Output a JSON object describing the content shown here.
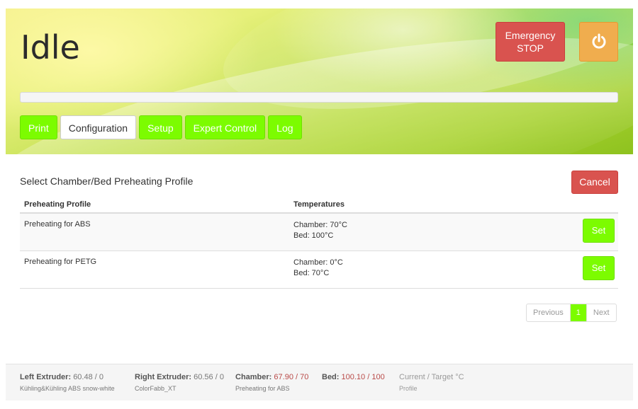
{
  "header": {
    "status": "Idle",
    "emergency_label_line1": "Emergency",
    "emergency_label_line2": "STOP",
    "progress": 0
  },
  "tabs": [
    {
      "label": "Print",
      "active": false
    },
    {
      "label": "Configuration",
      "active": true
    },
    {
      "label": "Setup",
      "active": false
    },
    {
      "label": "Expert Control",
      "active": false
    },
    {
      "label": "Log",
      "active": false
    }
  ],
  "main": {
    "title": "Select Chamber/Bed Preheating Profile",
    "cancel_label": "Cancel",
    "table": {
      "headers": [
        "Preheating Profile",
        "Temperatures"
      ],
      "rows": [
        {
          "profile": "Preheating for ABS",
          "chamber": "Chamber: 70°C",
          "bed": "Bed: 100°C",
          "action": "Set"
        },
        {
          "profile": "Preheating for PETG",
          "chamber": "Chamber: 0°C",
          "bed": "Bed: 70°C",
          "action": "Set"
        }
      ]
    },
    "pagination": {
      "prev": "Previous",
      "page": "1",
      "next": "Next"
    }
  },
  "footer": {
    "left_extruder": {
      "label": "Left Extruder:",
      "value": "60.48 / 0",
      "sub": "Kühling&Kühling ABS snow-white"
    },
    "right_extruder": {
      "label": "Right Extruder:",
      "value": "60.56 / 0",
      "sub": "ColorFabb_XT"
    },
    "chamber": {
      "label": "Chamber:",
      "value": "67.90 / 70",
      "sub": "Preheating for ABS"
    },
    "bed": {
      "label": "Bed:",
      "value": "100.10 / 100"
    },
    "legend": {
      "label": "Current / Target °C",
      "sub": "Profile"
    }
  },
  "colors": {
    "accent_green": "#7cfc00",
    "danger": "#d9534f",
    "warning": "#f0ad4e"
  }
}
